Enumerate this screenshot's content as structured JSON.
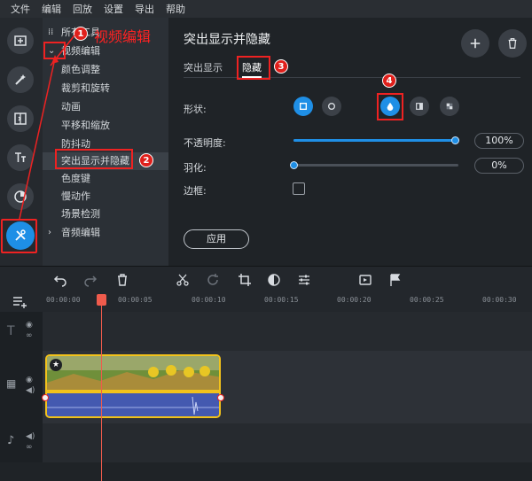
{
  "menu": [
    "文件",
    "编辑",
    "回放",
    "设置",
    "导出",
    "帮助"
  ],
  "sidebar": {
    "items": [
      {
        "prefix": "⁞⁞",
        "label": "所有工具"
      },
      {
        "prefix": "⌄",
        "label": "视频编辑"
      },
      {
        "prefix": "",
        "label": "颜色调整"
      },
      {
        "prefix": "",
        "label": "裁剪和旋转"
      },
      {
        "prefix": "",
        "label": "动画"
      },
      {
        "prefix": "",
        "label": "平移和缩放"
      },
      {
        "prefix": "",
        "label": "防抖动"
      },
      {
        "prefix": "",
        "label": "突出显示并隐藏"
      },
      {
        "prefix": "",
        "label": "色度键"
      },
      {
        "prefix": "",
        "label": "慢动作"
      },
      {
        "prefix": "",
        "label": "场景检测"
      },
      {
        "prefix": "›",
        "label": "音频编辑"
      }
    ]
  },
  "panel": {
    "title": "突出显示并隐藏",
    "tabs": [
      "突出显示",
      "隐藏"
    ],
    "shape_label": "形状:",
    "opacity_label": "不透明度:",
    "opacity_value": "100%",
    "opacity_level": 1.0,
    "feather_label": "羽化:",
    "feather_value": "0%",
    "feather_level": 0.0,
    "border_label": "边框:",
    "apply_label": "应用"
  },
  "annotations": {
    "one": "1",
    "two": "2",
    "three": "3",
    "four": "4",
    "video_edit_note": "视频编辑"
  },
  "timeline": {
    "ticks": [
      "00:00:00",
      "00:00:05",
      "00:00:10",
      "00:00:15",
      "00:00:20",
      "00:00:25",
      "00:00:30"
    ]
  },
  "colors": {
    "accent": "#1f8fe6",
    "annotation": "#e22222",
    "clip_border": "#f2c21b",
    "playhead": "#ef5b4c"
  }
}
